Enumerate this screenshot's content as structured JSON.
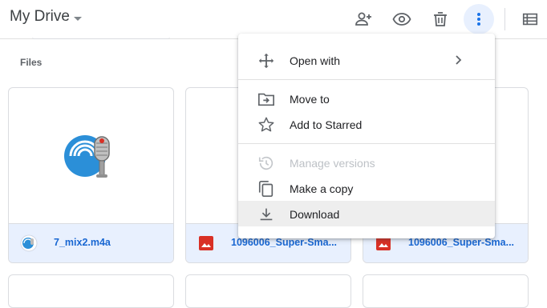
{
  "header": {
    "title": "My Drive",
    "actions": [
      {
        "icon": "add-person-icon"
      },
      {
        "icon": "eye-icon"
      },
      {
        "icon": "trash-icon"
      },
      {
        "icon": "more-vert-icon"
      },
      {
        "icon": "list-view-icon"
      }
    ]
  },
  "section": {
    "files_label": "Files"
  },
  "files": [
    {
      "name": "7_mix2.m4a",
      "type_icon": "audio-icon"
    },
    {
      "name": "1096006_Super-Sma...",
      "type_icon": "image-icon"
    },
    {
      "name": "1096006_Super-Sma...",
      "type_icon": "image-icon"
    }
  ],
  "context_menu": {
    "items": [
      {
        "label": "Open with",
        "icon": "move-arrows-icon",
        "submenu": true
      },
      {
        "label": "Move to",
        "icon": "move-to-folder-icon"
      },
      {
        "label": "Add to Starred",
        "icon": "star-icon"
      },
      {
        "label": "Manage versions",
        "icon": "history-icon",
        "disabled": true
      },
      {
        "label": "Make a copy",
        "icon": "copy-icon"
      },
      {
        "label": "Download",
        "icon": "download-icon",
        "highlighted": true
      }
    ]
  },
  "colors": {
    "accent": "#1967d2",
    "selected_bg": "#e8f0fe",
    "image_red": "#d93025"
  }
}
